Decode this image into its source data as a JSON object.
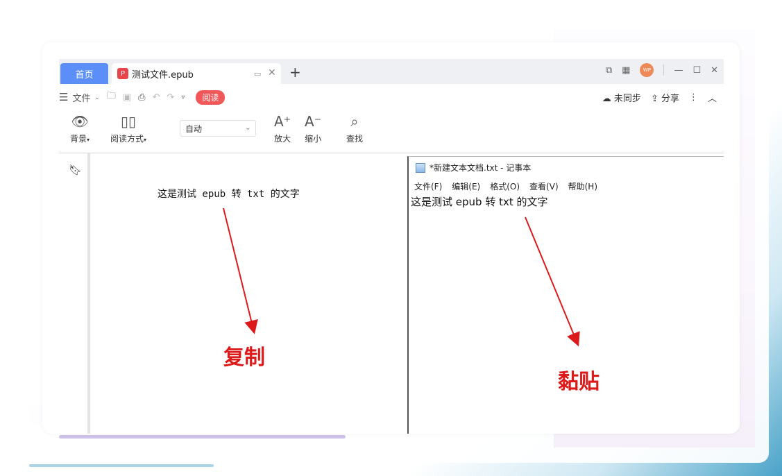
{
  "tabs": {
    "home_label": "首页",
    "doc_label": "测试文件.epub"
  },
  "window_controls": {
    "avatar_text": "WP"
  },
  "toolbar": {
    "file_menu": "文件",
    "read_badge": "阅读",
    "sync_label": "未同步",
    "share_label": "分享"
  },
  "ribbon": {
    "background_label": "背景",
    "read_mode_label": "阅读方式",
    "zoom_select_value": "自动",
    "zoom_in_label": "放大",
    "zoom_out_label": "缩小",
    "find_label": "查找"
  },
  "reader": {
    "page_text": "这是测试 epub 转 txt 的文字"
  },
  "notepad": {
    "title": "*新建文本文档.txt - 记事本",
    "menu": [
      "文件(F)",
      "编辑(E)",
      "格式(O)",
      "查看(V)",
      "帮助(H)"
    ],
    "content": "这是测试 epub 转 txt 的文字"
  },
  "annotations": {
    "copy_label": "复制",
    "paste_label": "黏贴",
    "arrow_color": "#dd1a1a"
  }
}
